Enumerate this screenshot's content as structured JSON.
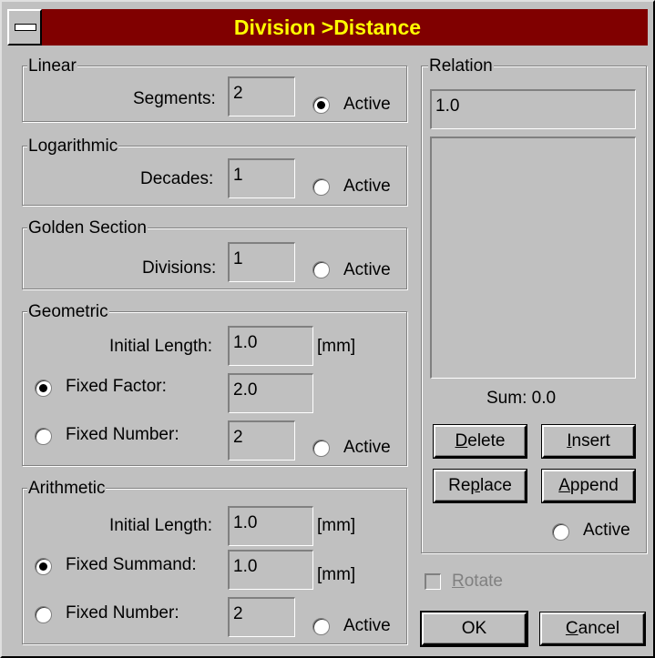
{
  "title": "Division >Distance",
  "linear": {
    "legend": "Linear",
    "label": "Segments:",
    "value": "2",
    "active": "Active",
    "active_checked": true
  },
  "logarithmic": {
    "legend": "Logarithmic",
    "label": "Decades:",
    "value": "1",
    "active": "Active",
    "active_checked": false
  },
  "golden": {
    "legend": "Golden Section",
    "label": "Divisions:",
    "value": "1",
    "active": "Active",
    "active_checked": false
  },
  "geometric": {
    "legend": "Geometric",
    "initial_label": "Initial Length:",
    "initial_value": "1.0",
    "unit": "[mm]",
    "factor_label": "Fixed Factor:",
    "factor_value": "2.0",
    "factor_checked": true,
    "number_label": "Fixed Number:",
    "number_value": "2",
    "number_checked": false,
    "active": "Active",
    "active_checked": false
  },
  "arithmetic": {
    "legend": "Arithmetic",
    "initial_label": "Initial Length:",
    "initial_value": "1.0",
    "unit": "[mm]",
    "summand_label": "Fixed Summand:",
    "summand_value": "1.0",
    "summand_unit": "[mm]",
    "summand_checked": true,
    "number_label": "Fixed Number:",
    "number_value": "2",
    "number_checked": false,
    "active": "Active",
    "active_checked": false
  },
  "relation": {
    "legend": "Relation",
    "value": "1.0",
    "list_items": [],
    "sum": "Sum: 0.0",
    "delete_pre": "",
    "delete_u": "D",
    "delete_post": "elete",
    "insert_pre": "",
    "insert_u": "I",
    "insert_post": "nsert",
    "replace_pre": "Re",
    "replace_u": "p",
    "replace_post": "lace",
    "append_pre": "",
    "append_u": "A",
    "append_post": "ppend",
    "active": "Active",
    "active_checked": false
  },
  "rotate_pre": "",
  "rotate_u": "R",
  "rotate_post": "otate",
  "ok_label": "OK",
  "cancel_pre": "",
  "cancel_u": "C",
  "cancel_post": "ancel"
}
